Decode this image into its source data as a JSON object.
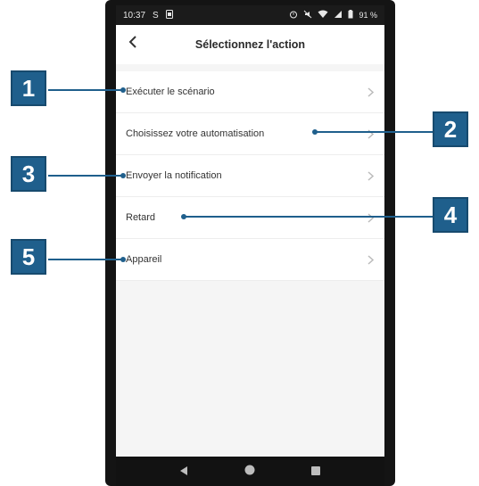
{
  "status_bar": {
    "time": "10:37",
    "carrier_letter": "S",
    "battery_text": "91 %"
  },
  "header": {
    "title": "Sélectionnez l'action",
    "back_icon": "chevron-left-icon"
  },
  "actions": [
    {
      "label": "Exécuter le scénario"
    },
    {
      "label": "Choisissez votre automatisation"
    },
    {
      "label": "Envoyer la notification"
    },
    {
      "label": "Retard"
    },
    {
      "label": "Appareil"
    }
  ],
  "callouts": [
    "1",
    "2",
    "3",
    "4",
    "5"
  ],
  "colors": {
    "callout": "#1f5f8c",
    "screen_bg": "#f5f5f5",
    "status_bar": "#1b1b1b"
  },
  "nav_icons": [
    "back-triangle-icon",
    "home-circle-icon",
    "recents-square-icon"
  ]
}
